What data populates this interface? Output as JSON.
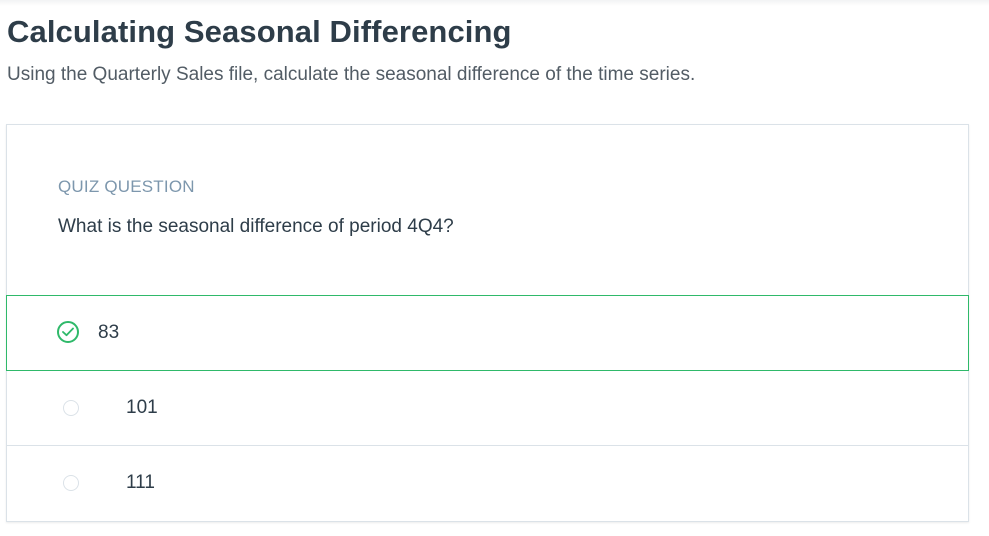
{
  "header": {
    "title": "Calculating Seasonal Differencing",
    "subtitle": "Using the Quarterly Sales file, calculate the seasonal difference of the time series."
  },
  "quiz": {
    "label": "QUIZ QUESTION",
    "question": "What is the seasonal difference of period 4Q4?",
    "options": [
      {
        "label": "83",
        "state": "correct",
        "icon": "check-circle-icon"
      },
      {
        "label": "101",
        "state": "unselected",
        "icon": "radio-icon"
      },
      {
        "label": "111",
        "state": "unselected",
        "icon": "radio-icon"
      }
    ]
  },
  "colors": {
    "title": "#2e3d49",
    "label": "#7d97ad",
    "correct": "#2fb96a",
    "border": "#dbe2e8"
  }
}
